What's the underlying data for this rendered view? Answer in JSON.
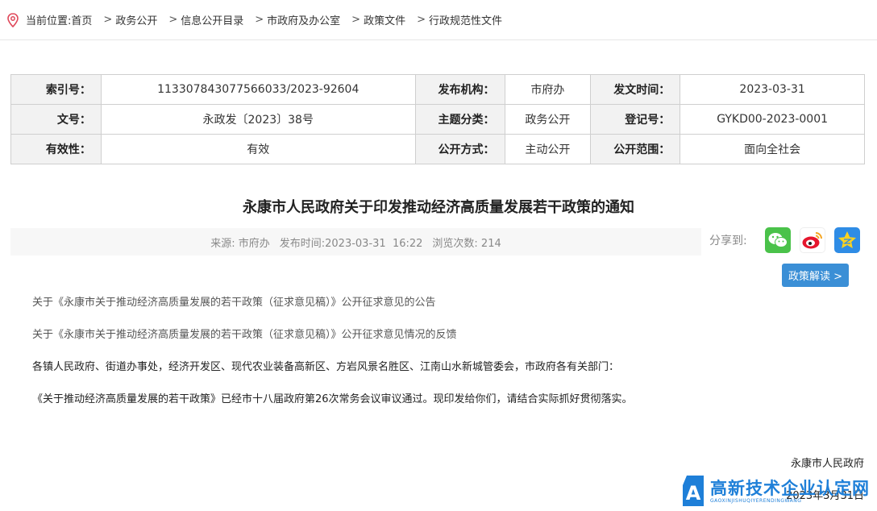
{
  "breadcrumb": {
    "prefix": "当前位置:",
    "home": "首页",
    "items": [
      "政务公开",
      "信息公开目录",
      "市政府及办公室",
      "政策文件",
      "行政规范性文件"
    ]
  },
  "meta": {
    "rows": [
      [
        {
          "k": "索引号：",
          "v": "113307843077566033/2023-92604"
        },
        {
          "k": "发布机构：",
          "v": "市府办"
        },
        {
          "k": "发文时间：",
          "v": "2023-03-31"
        }
      ],
      [
        {
          "k": "文号：",
          "v": "永政发〔2023〕38号"
        },
        {
          "k": "主题分类：",
          "v": "政务公开"
        },
        {
          "k": "登记号：",
          "v": "GYKD00-2023-0001"
        }
      ],
      [
        {
          "k": "有效性：",
          "v": "有效"
        },
        {
          "k": "公开方式：",
          "v": "主动公开"
        },
        {
          "k": "公开范围：",
          "v": "面向全社会"
        }
      ]
    ]
  },
  "doc": {
    "title": "永康市人民政府关于印发推动经济高质量发展若干政策的通知",
    "source": "来源: 市府办",
    "publish_time": "发布时间:2023-03-31  16:22",
    "views": "浏览次数: 214"
  },
  "share": {
    "label": "分享到:",
    "icons": [
      "wechat-icon",
      "weibo-icon",
      "qzone-icon"
    ]
  },
  "policy_button": "政策解读 >",
  "content": {
    "links": [
      "关于《永康市关于推动经济高质量发展的若干政策（征求意见稿）》公开征求意见的公告",
      "关于《永康市关于推动经济高质量发展的若干政策（征求意见稿）》公开征求意见情况的反馈"
    ],
    "paragraphs": [
      "各镇人民政府、街道办事处，经济开发区、现代农业装备高新区、方岩风景名胜区、江南山水新城管委会，市政府各有关部门：",
      "《关于推动经济高质量发展的若干政策》已经市十八届政府第26次常务会议审议通过。现印发给你们，请结合实际抓好贯彻落实。"
    ],
    "signature": "永康市人民政府",
    "date": "2023年3月31日"
  },
  "watermark": {
    "cn": "高新技术企业认定网",
    "en": "GAOXINJISHUQIYERENDINGWANG"
  },
  "colors": {
    "accent": "#3b8fd6",
    "pin": "#e0495b",
    "wechat": "#4ac24a",
    "qzone": "#2f8ce5",
    "watermark": "#1e7fd8"
  }
}
